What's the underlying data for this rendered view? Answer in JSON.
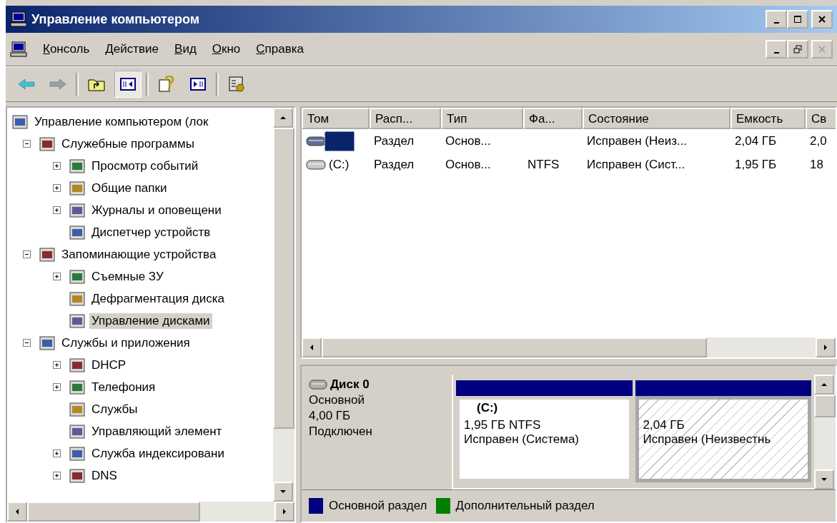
{
  "window": {
    "title": "Управление компьютером"
  },
  "menu": [
    {
      "label": "Консоль"
    },
    {
      "label": "Действие"
    },
    {
      "label": "Вид"
    },
    {
      "label": "Окно"
    },
    {
      "label": "Справка"
    }
  ],
  "toolbar": [
    {
      "kind": "back",
      "disabled": false,
      "pressed": false
    },
    {
      "kind": "forward",
      "disabled": true,
      "pressed": false
    },
    {
      "kind": "sep"
    },
    {
      "kind": "up",
      "pressed": false
    },
    {
      "kind": "tree",
      "pressed": true
    },
    {
      "kind": "sep"
    },
    {
      "kind": "help",
      "pressed": false
    },
    {
      "kind": "pane",
      "pressed": false
    },
    {
      "kind": "sep"
    },
    {
      "kind": "props",
      "pressed": false
    }
  ],
  "tree": [
    {
      "label": "Управление компьютером (лок",
      "selected": false,
      "children": [
        {
          "label": "Служебные программы",
          "expanded": true,
          "selected": false,
          "children": [
            {
              "label": "Просмотр событий",
              "expanded": false,
              "selected": false
            },
            {
              "label": "Общие папки",
              "expanded": false,
              "selected": false
            },
            {
              "label": "Журналы и оповещени",
              "expanded": false,
              "selected": false
            },
            {
              "label": "Диспетчер устройств",
              "selected": false
            }
          ]
        },
        {
          "label": "Запоминающие устройства",
          "expanded": true,
          "selected": false,
          "children": [
            {
              "label": "Съемные ЗУ",
              "expanded": false,
              "selected": false
            },
            {
              "label": "Дефрагментация диска",
              "selected": false
            },
            {
              "label": "Управление дисками",
              "selected": true
            }
          ]
        },
        {
          "label": "Службы и приложения",
          "expanded": true,
          "selected": false,
          "children": [
            {
              "label": "DHCP",
              "expanded": false,
              "selected": false
            },
            {
              "label": "Телефония",
              "expanded": false,
              "selected": false
            },
            {
              "label": "Службы",
              "selected": false
            },
            {
              "label": "Управляющий элемент",
              "selected": false
            },
            {
              "label": "Служба индексировани",
              "expanded": false,
              "selected": false
            },
            {
              "label": "DNS",
              "expanded": false,
              "selected": false
            }
          ]
        }
      ]
    }
  ],
  "table": {
    "columns": [
      "Том",
      "Расп...",
      "Тип",
      "Фа...",
      "Состояние",
      "Емкость",
      "Св"
    ],
    "rows": [
      {
        "selected": true,
        "cells": [
          null,
          "Раздел",
          "Основ...",
          null,
          "Исправен (Неиз...",
          "2,04 ГБ",
          "2,0"
        ]
      },
      {
        "selected": false,
        "cells": [
          "(C:)",
          "Раздел",
          "Основ...",
          "NTFS",
          "Исправен (Сист...",
          "1,95 ГБ",
          "18"
        ]
      }
    ]
  },
  "disk": {
    "name": "Диск 0",
    "type": "Основной",
    "size": "4,00 ГБ",
    "status": "Подключен",
    "partitions": [
      {
        "label": "(C:)",
        "size": "1,95 ГБ NTFS",
        "status": "Исправен (Система)",
        "hatched": false,
        "selected": false
      },
      {
        "size": "2,04 ГБ",
        "status": "Исправен (Неизвестнь",
        "hatched": true,
        "selected": true
      }
    ]
  },
  "legend": [
    {
      "label": "Основной раздел",
      "color": "#000080"
    },
    {
      "label": "Дополнительный раздел",
      "color": "#008000"
    }
  ]
}
